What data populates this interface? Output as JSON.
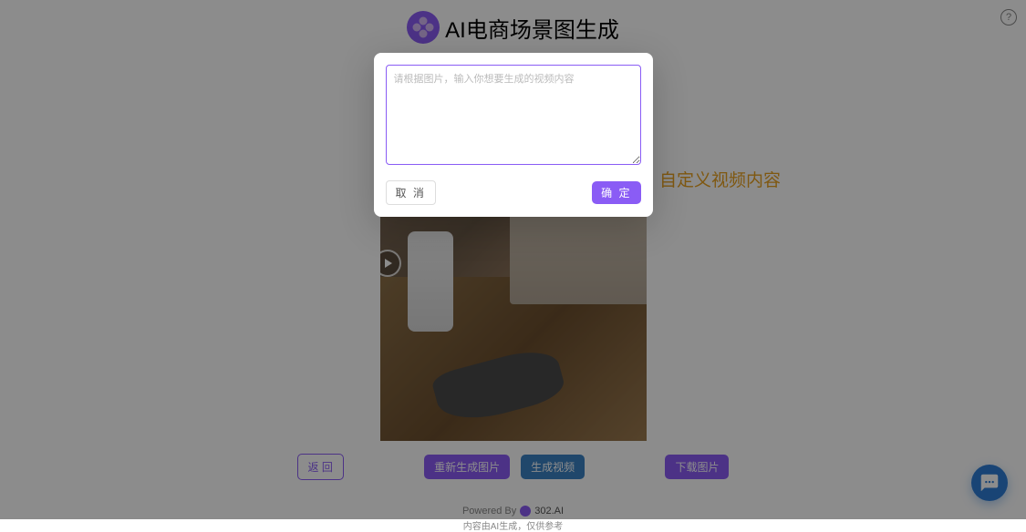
{
  "header": {
    "title": "AI电商场景图生成"
  },
  "annotation": {
    "text": "自定义视频内容"
  },
  "actions": {
    "back_label": "返 回",
    "regenerate_label": "重新生成图片",
    "generate_video_label": "生成视频",
    "download_label": "下载图片"
  },
  "footer": {
    "powered_by": "Powered By",
    "brand": "302.AI",
    "disclaimer": "内容由AI生成，仅供参考"
  },
  "modal": {
    "placeholder": "请根据图片，输入你想要生成的视频内容",
    "cancel_label": "取 消",
    "confirm_label": "确 定"
  }
}
